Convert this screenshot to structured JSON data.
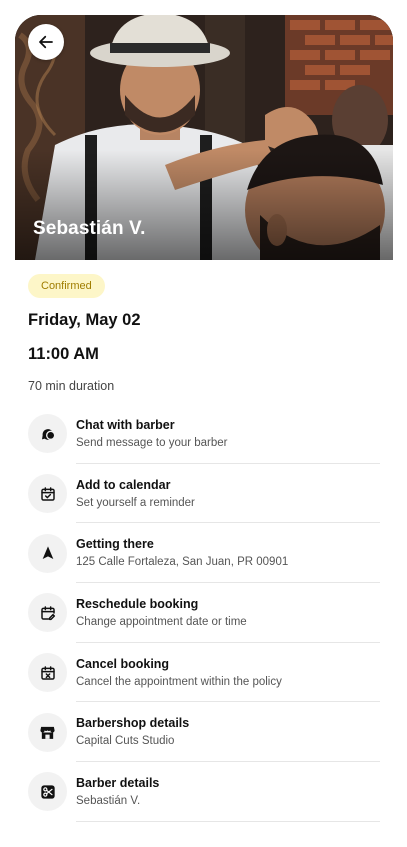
{
  "hero": {
    "barber_name": "Sebastián V.",
    "back_icon": "arrow-left-icon"
  },
  "booking": {
    "status": "Confirmed",
    "status_color": "#fdf6c8",
    "date": "Friday, May 02",
    "time": "11:00 AM",
    "duration": "70 min duration"
  },
  "actions": [
    {
      "icon": "chat-bubbles-icon",
      "title": "Chat with barber",
      "subtitle": "Send message to your barber"
    },
    {
      "icon": "calendar-check-icon",
      "title": "Add to calendar",
      "subtitle": "Set yourself a reminder"
    },
    {
      "icon": "navigation-arrow-icon",
      "title": "Getting there",
      "subtitle": "125 Calle Fortaleza, San Juan, PR 00901"
    },
    {
      "icon": "calendar-edit-icon",
      "title": "Reschedule booking",
      "subtitle": "Change appointment date or time"
    },
    {
      "icon": "calendar-cancel-icon",
      "title": "Cancel booking",
      "subtitle": "Cancel the appointment within the policy"
    },
    {
      "icon": "storefront-icon",
      "title": "Barbershop details",
      "subtitle": "Capital Cuts Studio"
    },
    {
      "icon": "scissors-icon",
      "title": "Barber details",
      "subtitle": "Sebastián V."
    }
  ]
}
